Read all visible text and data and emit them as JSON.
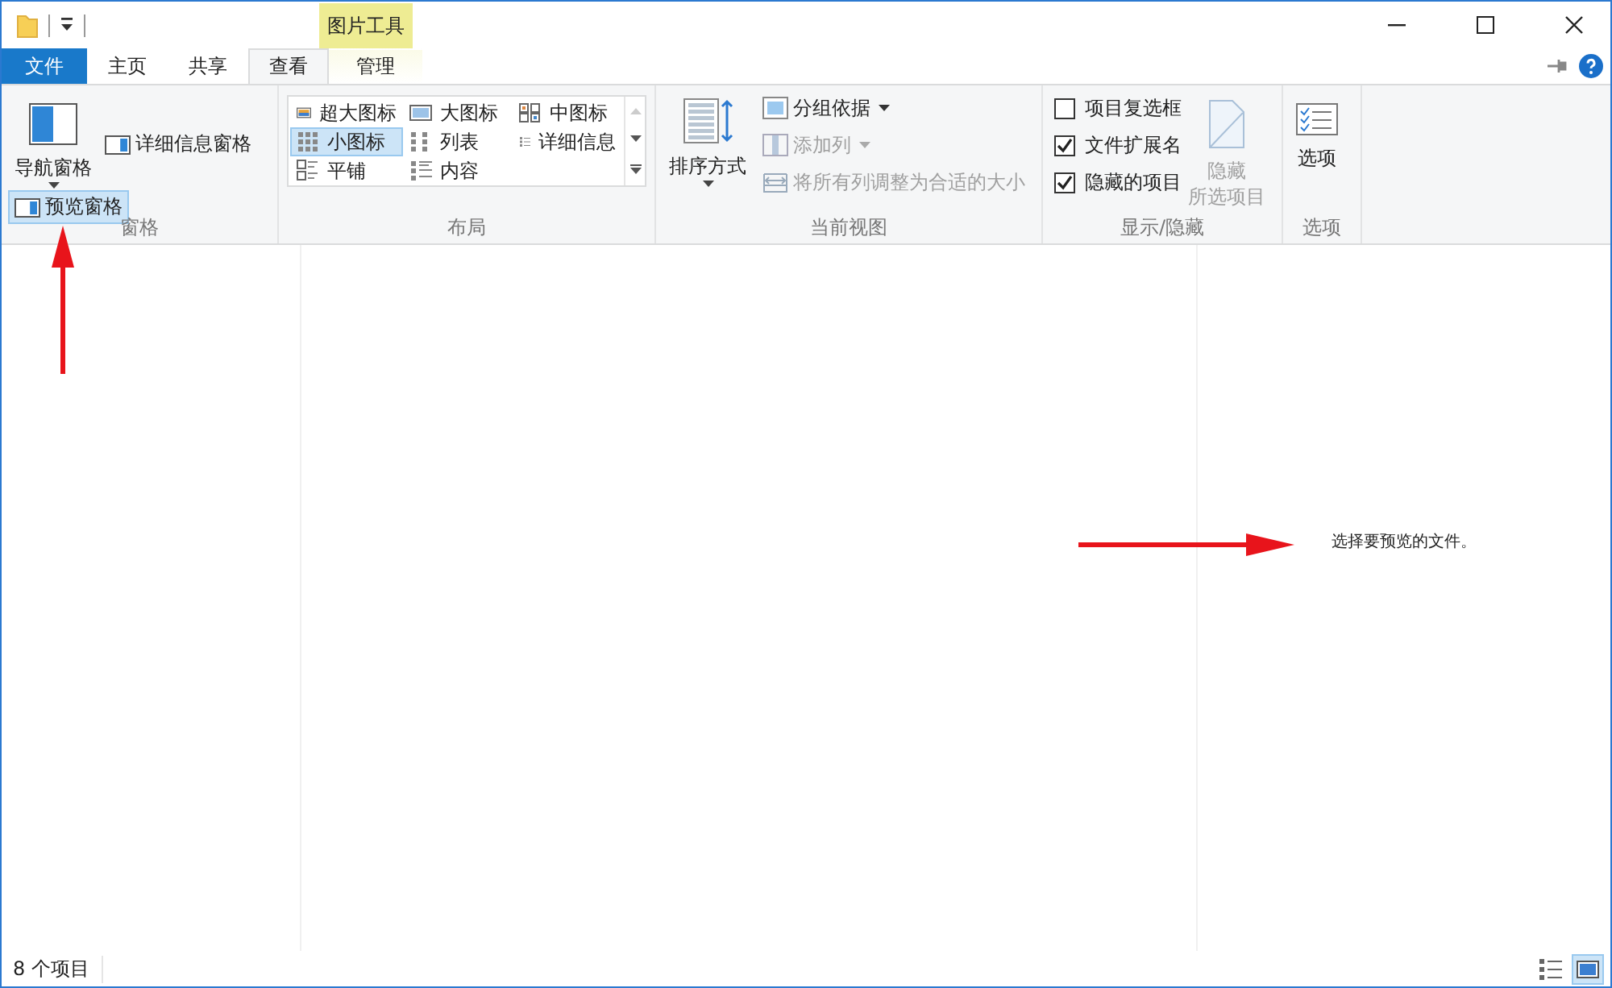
{
  "context_tab_group": {
    "label": "图片工具"
  },
  "tabs": [
    {
      "label": "文件",
      "kind": "file",
      "selected": false
    },
    {
      "label": "主页",
      "kind": "normal",
      "selected": false
    },
    {
      "label": "共享",
      "kind": "normal",
      "selected": false
    },
    {
      "label": "查看",
      "kind": "normal",
      "selected": true
    },
    {
      "label": "管理",
      "kind": "contextual",
      "selected": false
    }
  ],
  "ribbon": {
    "panes": {
      "label": "窗格",
      "navigation_pane": {
        "label": "导航窗格"
      },
      "preview_pane": {
        "label": "预览窗格",
        "selected": true
      },
      "details_pane": {
        "label": "详细信息窗格",
        "selected": false
      }
    },
    "layout": {
      "label": "布局",
      "options": [
        {
          "label": "超大图标",
          "kind": "xl",
          "selected": false
        },
        {
          "label": "大图标",
          "kind": "large",
          "selected": false
        },
        {
          "label": "中图标",
          "kind": "medium",
          "selected": false
        },
        {
          "label": "小图标",
          "kind": "small",
          "selected": true
        },
        {
          "label": "列表",
          "kind": "list",
          "selected": false
        },
        {
          "label": "详细信息",
          "kind": "details",
          "selected": false
        },
        {
          "label": "平铺",
          "kind": "tiles",
          "selected": false
        },
        {
          "label": "内容",
          "kind": "content",
          "selected": false
        }
      ]
    },
    "current_view": {
      "label": "当前视图",
      "sort_by": {
        "label": "排序方式"
      },
      "commands": [
        {
          "label": "分组依据",
          "kind": "group",
          "dropdown": true,
          "disabled": false
        },
        {
          "label": "添加列",
          "kind": "columns",
          "dropdown": true,
          "disabled": true
        },
        {
          "label": "将所有列调整为合适的大小",
          "kind": "fit",
          "dropdown": false,
          "disabled": true
        }
      ]
    },
    "show_hide": {
      "label": "显示/隐藏",
      "checkboxes": [
        {
          "label": "项目复选框",
          "checked": false
        },
        {
          "label": "文件扩展名",
          "checked": true
        },
        {
          "label": "隐藏的项目",
          "checked": true
        }
      ],
      "hide_selected": {
        "lines": [
          "隐藏",
          "所选项目"
        ],
        "disabled": true
      }
    },
    "options": {
      "group_label": "选项",
      "label": "选项"
    }
  },
  "preview_pane": {
    "message": "选择要预览的文件。"
  },
  "status_bar": {
    "item_count": "8 个项目",
    "view_buttons": [
      {
        "kind": "details",
        "selected": false
      },
      {
        "kind": "large_icons",
        "selected": true
      }
    ]
  }
}
